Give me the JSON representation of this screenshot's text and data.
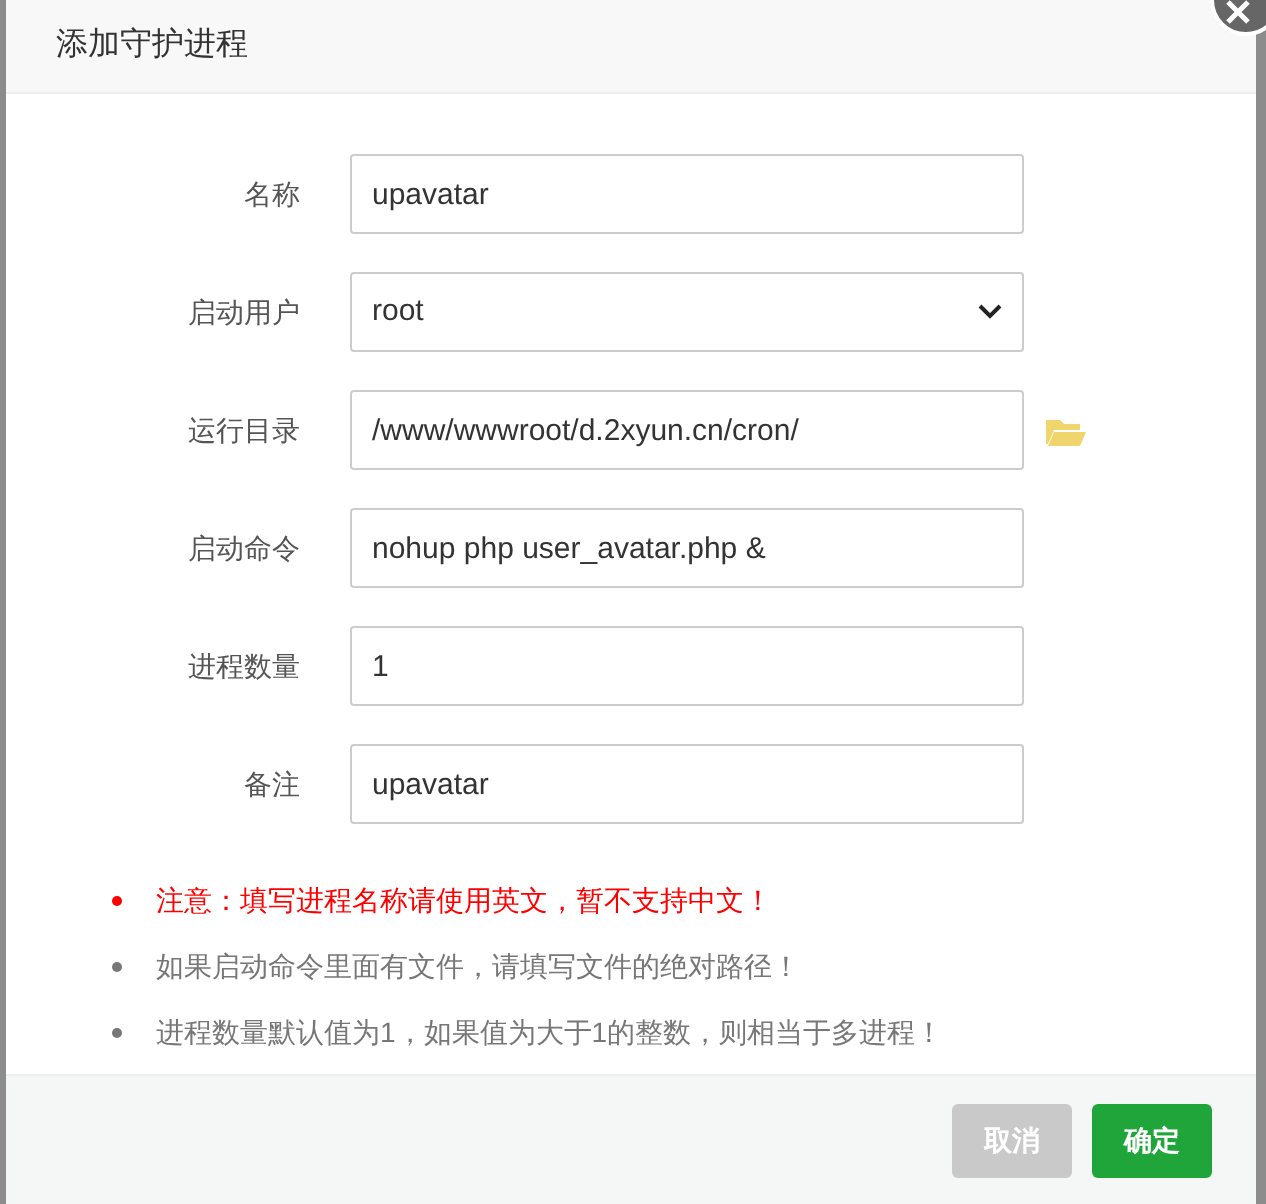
{
  "dialog": {
    "title": "添加守护进程"
  },
  "fields": [
    {
      "label": "名称",
      "kind": "text",
      "value": "upavatar"
    },
    {
      "label": "启动用户",
      "kind": "select",
      "value": "root"
    },
    {
      "label": "运行目录",
      "kind": "folder",
      "value": "/www/wwwroot/d.2xyun.cn/cron/"
    },
    {
      "label": "启动命令",
      "kind": "text",
      "value": "nohup php user_avatar.php &"
    },
    {
      "label": "进程数量",
      "kind": "text",
      "value": "1"
    },
    {
      "label": "备注",
      "kind": "text",
      "value": "upavatar"
    }
  ],
  "notes": [
    {
      "kind": "warning",
      "text": "注意：填写进程名称请使用英文，暂不支持中文！"
    },
    {
      "kind": "info",
      "text": "如果启动命令里面有文件，请填写文件的绝对路径！"
    },
    {
      "kind": "info",
      "text": "进程数量默认值为1，如果值为大于1的整数，则相当于多进程！"
    }
  ],
  "buttons": [
    {
      "kind": "cancel",
      "label": "取消"
    },
    {
      "kind": "confirm",
      "label": "确定"
    }
  ]
}
